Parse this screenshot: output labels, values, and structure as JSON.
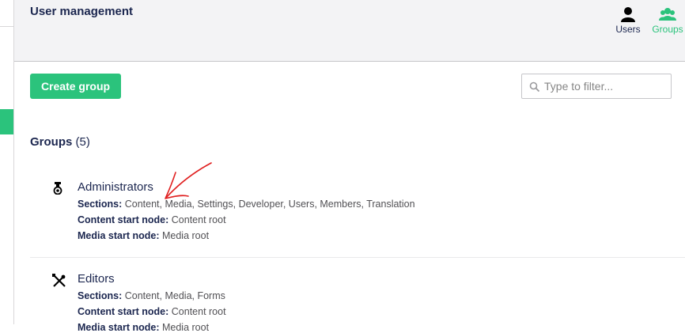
{
  "header": {
    "title": "User management",
    "nav": [
      {
        "label": "Users",
        "icon": "user-icon"
      },
      {
        "label": "Groups",
        "icon": "groups-icon"
      }
    ]
  },
  "toolbar": {
    "create_label": "Create group",
    "filter_placeholder": "Type to filter..."
  },
  "groups_section": {
    "label": "Groups",
    "count": "(5)"
  },
  "groups": [
    {
      "name": "Administrators",
      "icon": "medal-icon",
      "sections_label": "Sections:",
      "sections": "Content, Media, Settings, Developer, Users, Members, Translation",
      "content_label": "Content start node:",
      "content": "Content root",
      "media_label": "Media start node:",
      "media": "Media root"
    },
    {
      "name": "Editors",
      "icon": "tools-icon",
      "sections_label": "Sections:",
      "sections": "Content, Media, Forms",
      "content_label": "Content start node:",
      "content": "Content root",
      "media_label": "Media start node:",
      "media": "Media root"
    }
  ],
  "colors": {
    "accent": "#2bc37c",
    "text": "#1b264f",
    "annotation": "#e02020"
  }
}
